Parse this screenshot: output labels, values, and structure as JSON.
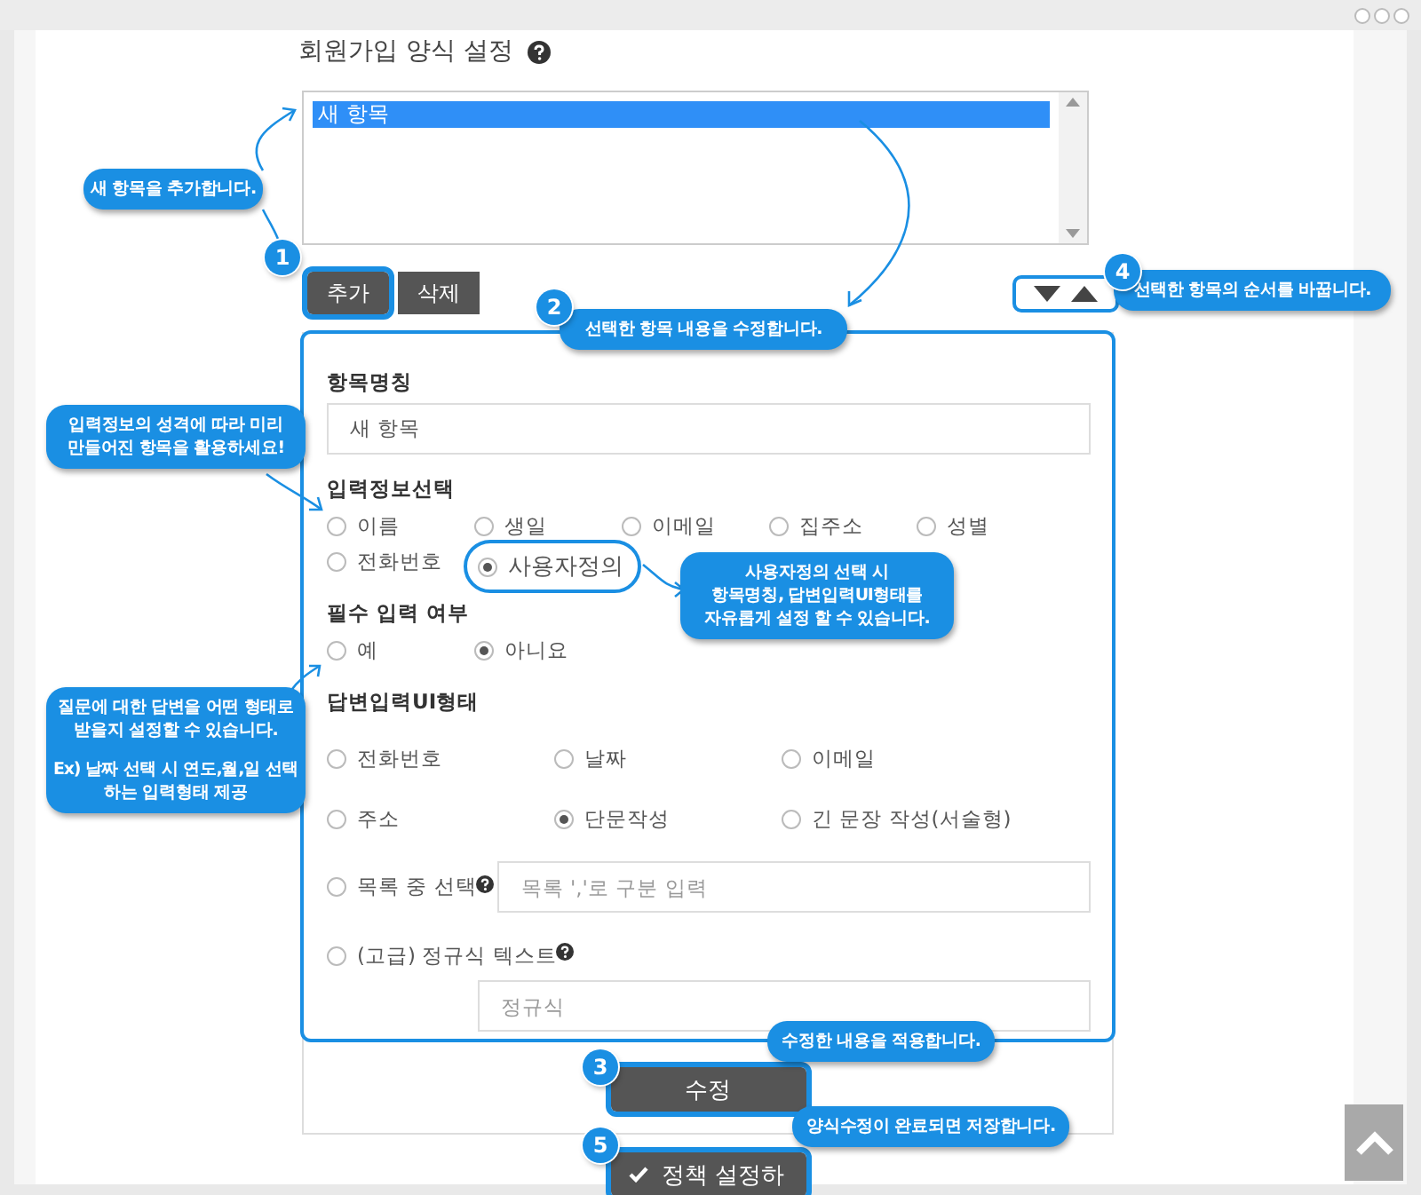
{
  "title": "회원가입 양식 설정",
  "item_list": [
    {
      "label": "새 항목",
      "selected": true
    }
  ],
  "list_buttons": [
    {
      "label": "추가",
      "highlighted": true
    },
    {
      "label": "삭제",
      "highlighted": false
    }
  ],
  "order_controls": {
    "highlighted": true
  },
  "form": {
    "highlighted": true,
    "name_label": "항목명칭",
    "name_value": "새 항목",
    "info_label": "입력정보선택",
    "info_options": [
      {
        "label": "이름",
        "selected": false
      },
      {
        "label": "생일",
        "selected": false
      },
      {
        "label": "이메일",
        "selected": false
      },
      {
        "label": "집주소",
        "selected": false
      },
      {
        "label": "성별",
        "selected": false
      },
      {
        "label": "전화번호",
        "selected": false
      },
      {
        "label": "사용자정의",
        "selected": true,
        "highlighted": true
      }
    ],
    "required_label": "필수 입력 여부",
    "required_options": [
      {
        "label": "예",
        "selected": false
      },
      {
        "label": "아니요",
        "selected": true
      }
    ],
    "ui_label": "답변입력UI형태",
    "ui_options": [
      {
        "label": "전화번호",
        "selected": false
      },
      {
        "label": "날짜",
        "selected": false
      },
      {
        "label": "이메일",
        "selected": false
      },
      {
        "label": "주소",
        "selected": false
      },
      {
        "label": "단문작성",
        "selected": true
      },
      {
        "label": "긴 문장 작성(서술형)",
        "selected": false
      }
    ],
    "list_option": {
      "label": "목록 중 선택",
      "selected": false,
      "placeholder": "목록 ','로 구분 입력"
    },
    "regex_option": {
      "label": "(고급) 정규식 텍스트",
      "selected": false,
      "placeholder": "정규식"
    }
  },
  "apply_button": {
    "label": "수정",
    "highlighted": true
  },
  "save_button": {
    "label": "정책 설정하",
    "highlighted": true
  },
  "callouts": [
    {
      "number": "1",
      "lines": [
        "새 항목을 추가합니다."
      ]
    },
    {
      "number": "2",
      "lines": [
        "선택한 항목 내용을 수정합니다."
      ]
    },
    {
      "number": "3",
      "lines": [
        "수정한 내용을 적용합니다."
      ]
    },
    {
      "number": "4",
      "lines": [
        "선택한 항목의 순서를 바꿉니다."
      ]
    },
    {
      "number": "5",
      "lines": [
        "양식수정이 완료되면 저장합니다."
      ]
    },
    {
      "lines": [
        "입력정보의 성격에 따라 미리",
        "만들어진 항목을 활용하세요!"
      ]
    },
    {
      "lines": [
        "사용자정의 선택 시",
        "항목명칭, 답변입력UI형태를",
        "자유롭게 설정 할 수 있습니다."
      ]
    },
    {
      "lines": [
        "질문에 대한 답변을 어떤 형태로",
        "받을지 설정할 수 있습니다."
      ],
      "example_lines": [
        "Ex) 날짜 선택 시 연도,월,일 선택",
        "하는 입력형태 제공"
      ]
    }
  ]
}
